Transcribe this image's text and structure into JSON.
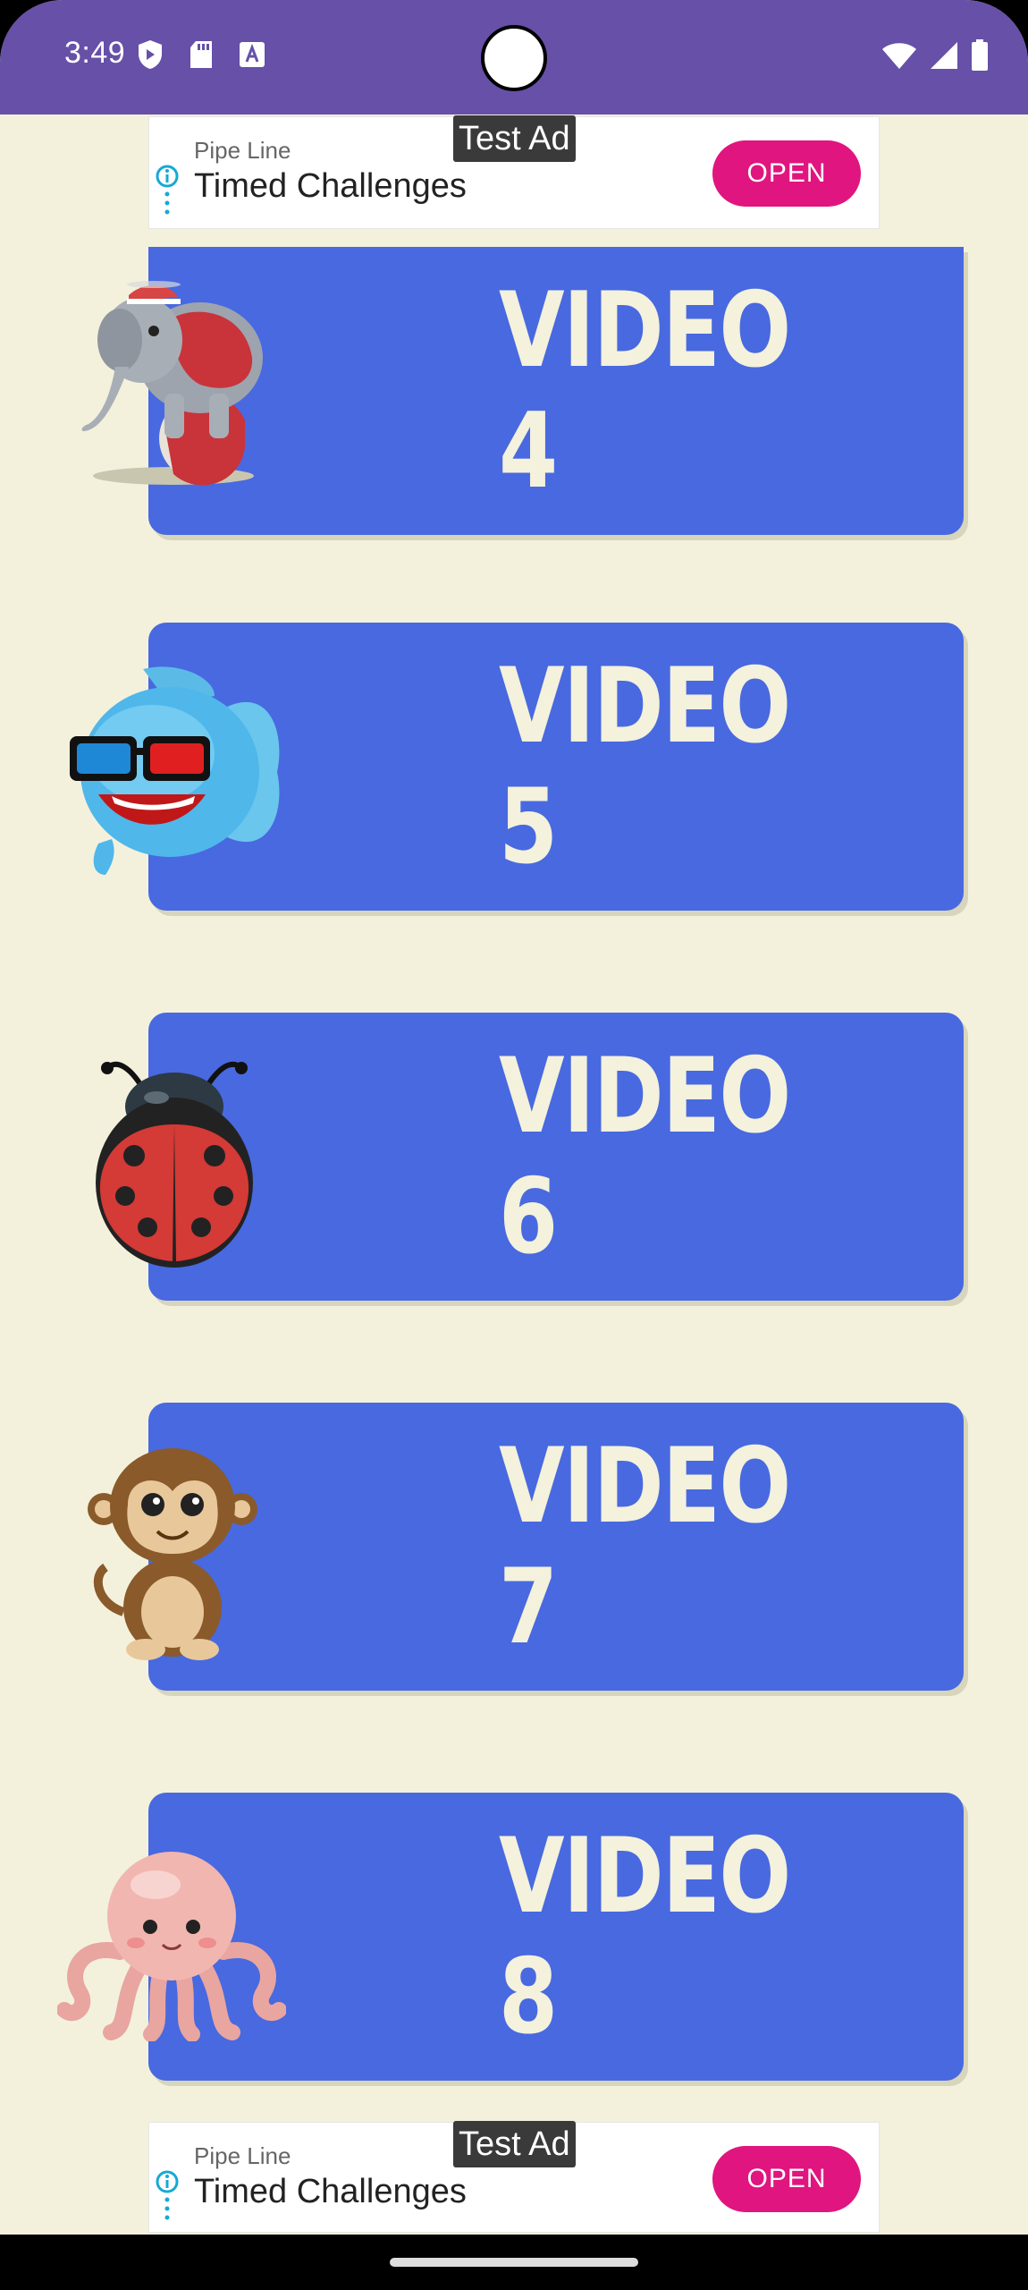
{
  "status_bar": {
    "time": "3:49",
    "icons_left": [
      "shield-icon",
      "sd-card-icon",
      "font-a-icon"
    ],
    "icons_right": [
      "wifi-icon",
      "signal-icon",
      "battery-icon"
    ],
    "background_color": "#6650A8"
  },
  "ad_top": {
    "badge": "Test Ad",
    "advertiser": "Pipe Line",
    "headline": "Timed Challenges",
    "cta": "OPEN",
    "cta_color": "#E0157F"
  },
  "ad_bottom": {
    "badge": "Test Ad",
    "advertiser": "Pipe Line",
    "headline": "Timed Challenges",
    "cta": "OPEN",
    "cta_color": "#E0157F"
  },
  "videos": [
    {
      "label": "VIDEO 4",
      "animal": "elephant-icon"
    },
    {
      "label": "VIDEO 5",
      "animal": "fish-icon"
    },
    {
      "label": "VIDEO 6",
      "animal": "ladybug-icon"
    },
    {
      "label": "VIDEO 7",
      "animal": "monkey-icon"
    },
    {
      "label": "VIDEO 8",
      "animal": "octopus-icon"
    }
  ],
  "colors": {
    "background": "#F3F1DC",
    "card": "#4869E0",
    "card_text": "#F4F1DC"
  }
}
